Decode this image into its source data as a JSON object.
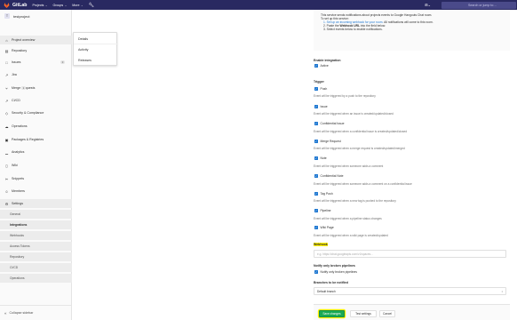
{
  "navbar": {
    "brand": "GitLab",
    "links": [
      "Projects",
      "Groups",
      "More"
    ],
    "chevron": "⌄",
    "search_placeholder": "Search or jump to…"
  },
  "sidebar": {
    "avatar_letter": "T",
    "project_name": "testproject",
    "items": [
      {
        "label": "Project overview",
        "icon": "home-icon"
      },
      {
        "label": "Repository",
        "icon": "book-icon"
      },
      {
        "label": "Issues",
        "icon": "issues-icon",
        "badge": "0"
      },
      {
        "label": "Jira",
        "icon": "jira-icon"
      },
      {
        "label": "Merge Requests",
        "icon": "merge-icon",
        "badge": "1"
      },
      {
        "label": "CI/CD",
        "icon": "rocket-icon"
      },
      {
        "label": "Security & Compliance",
        "icon": "shield-icon"
      },
      {
        "label": "Operations",
        "icon": "cloud-icon"
      },
      {
        "label": "Packages & Registries",
        "icon": "package-icon"
      },
      {
        "label": "Analytics",
        "icon": "chart-icon"
      },
      {
        "label": "Wiki",
        "icon": "wiki-icon"
      },
      {
        "label": "Snippets",
        "icon": "scissors-icon"
      },
      {
        "label": "Members",
        "icon": "users-icon"
      },
      {
        "label": "Settings",
        "icon": "gear-icon"
      }
    ],
    "settings_sub": [
      "General",
      "Integrations",
      "Webhooks",
      "Access Tokens",
      "Repository",
      "CI/CD",
      "Operations"
    ],
    "collapse": "Collapse sidebar"
  },
  "flyout": [
    "Details",
    "Activity",
    "Releases"
  ],
  "help": {
    "line1": "This service sends notifications about projects events to Google Hangouts Chat room.",
    "line2": "To set up this service:",
    "step1_link": "1. Set up an incoming webhook for your room.",
    "step1_rest": " All notifications will come to this room.",
    "step2_a": "2. Paste the ",
    "step2_b": "Webhook URL",
    "step2_c": " into the field below.",
    "step3": "3. Select events below to enable notifications."
  },
  "enable": {
    "label": "Enable integration",
    "active": "Active"
  },
  "trigger": {
    "label": "Trigger",
    "events": [
      {
        "name": "Push",
        "desc": "Event will be triggered by a push to the repository"
      },
      {
        "name": "Issue",
        "desc": "Event will be triggered when an issue is created/updated/closed"
      },
      {
        "name": "Confidential Issue",
        "desc": "Event will be triggered when a confidential issue is created/updated/closed"
      },
      {
        "name": "Merge Request",
        "desc": "Event will be triggered when a merge request is created/updated/merged"
      },
      {
        "name": "Note",
        "desc": "Event will be triggered when someone adds a comment"
      },
      {
        "name": "Confidential Note",
        "desc": "Event will be triggered when someone adds a comment on a confidential issue"
      },
      {
        "name": "Tag Push",
        "desc": "Event will be triggered when a new tag is pushed to the repository"
      },
      {
        "name": "Pipeline",
        "desc": "Event will be triggered when a pipeline status changes"
      },
      {
        "name": "Wiki Page",
        "desc": "Event will be triggered when a wiki page is created/updated"
      }
    ]
  },
  "webhook": {
    "label": "Webhook",
    "placeholder": "e.g. https://chat.googleapis.com/v1/spaces…"
  },
  "notify": {
    "label": "Notify only broken pipelines",
    "option": "Notify only broken pipelines"
  },
  "branches": {
    "label": "Branches to be notified",
    "value": "Default branch"
  },
  "buttons": {
    "save": "Save changes",
    "test": "Test settings",
    "cancel": "Cancel"
  },
  "colors": {
    "navbar": "#292961",
    "accent": "#1f78d1",
    "save": "#1aaa55",
    "highlight": "#fff200"
  }
}
